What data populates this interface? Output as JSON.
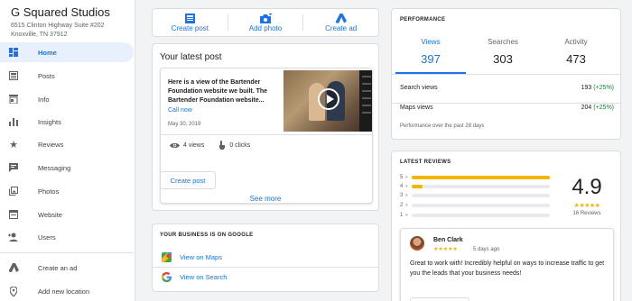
{
  "business": {
    "name": "G Squared Studios",
    "address": "6515 Clinton Highway Suite #202 Knoxville, TN 37912"
  },
  "sidebar": {
    "items": [
      {
        "label": "Home",
        "icon": "home-dashboard-icon"
      },
      {
        "label": "Posts",
        "icon": "posts-icon"
      },
      {
        "label": "Info",
        "icon": "info-store-icon"
      },
      {
        "label": "Insights",
        "icon": "insights-bar-icon"
      },
      {
        "label": "Reviews",
        "icon": "star-icon"
      },
      {
        "label": "Messaging",
        "icon": "message-icon"
      },
      {
        "label": "Photos",
        "icon": "photos-icon"
      },
      {
        "label": "Website",
        "icon": "website-icon"
      },
      {
        "label": "Users",
        "icon": "add-user-icon"
      },
      {
        "label": "Create an ad",
        "icon": "google-ads-icon"
      },
      {
        "label": "Add new location",
        "icon": "location-pin-icon"
      }
    ],
    "active_index": 0
  },
  "actions": {
    "create_post": "Create post",
    "add_photo": "Add photo",
    "create_ad": "Create ad"
  },
  "latest_post": {
    "title": "Your latest post",
    "text": "Here is a view of the Bartender Foundation website we built. The Bartender Foundation website...",
    "cta": "Call now",
    "date": "May 30, 2019",
    "views": "4 views",
    "clicks": "0 clicks",
    "create_post_button": "Create post",
    "see_more": "See more"
  },
  "business_on_google": {
    "title": "YOUR BUSINESS IS ON GOOGLE",
    "maps_link": "View on Maps",
    "search_link": "View on Search"
  },
  "performance": {
    "title": "PERFORMANCE",
    "tabs": [
      {
        "label": "Views",
        "value": "397"
      },
      {
        "label": "Searches",
        "value": "303"
      },
      {
        "label": "Activity",
        "value": "473"
      }
    ],
    "active_tab": 0,
    "search_views_label": "Search views",
    "search_views_value": "193",
    "search_views_change": "(+25%)",
    "maps_views_label": "Maps views",
    "maps_views_value": "204",
    "maps_views_change": "(+25%)",
    "footer": "Performance over the past 28 days"
  },
  "reviews": {
    "title": "LATEST REVIEWS",
    "distribution": [
      {
        "star": "5",
        "fraction": 1.0
      },
      {
        "star": "4",
        "fraction": 0.08
      },
      {
        "star": "3",
        "fraction": 0.0
      },
      {
        "star": "2",
        "fraction": 0.0
      },
      {
        "star": "1",
        "fraction": 0.0
      }
    ],
    "score": "4.9",
    "stars": "★★★★★",
    "count": "16 Reviews",
    "latest": {
      "name": "Ben Clark",
      "stars": "★★★★★",
      "ago": "5 days ago",
      "text": "Great to work with! Incredibly helpful on ways to increase traffic to get you the leads that your business needs!"
    }
  },
  "colors": {
    "accent": "#1a73e8",
    "star": "#f4b400",
    "positive": "#188038",
    "active_nav_bg": "#e8f0fe"
  }
}
